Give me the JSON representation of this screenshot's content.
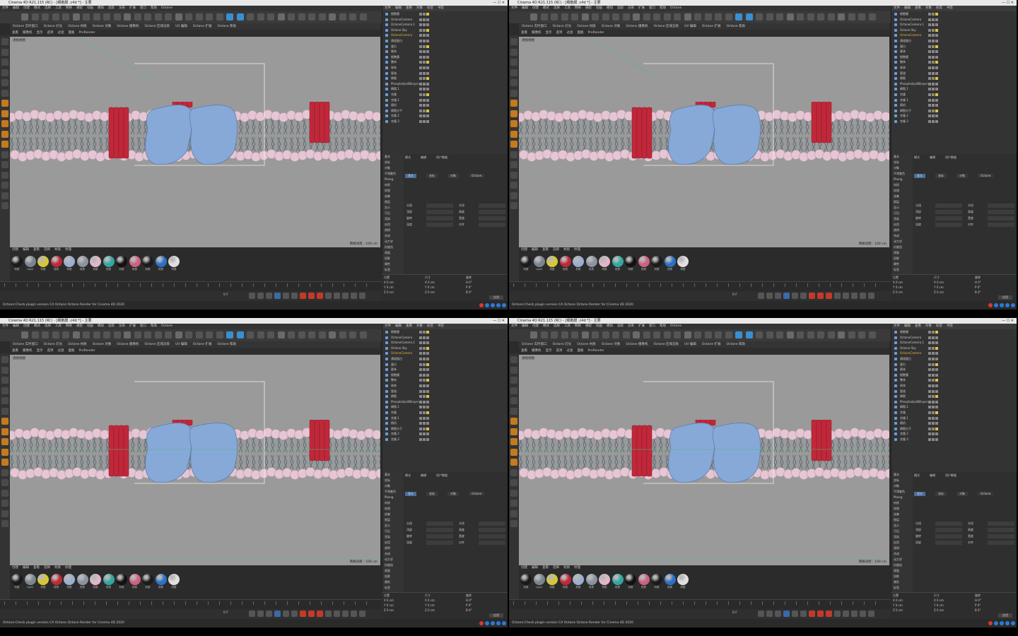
{
  "window": {
    "title": "Cinema 4D R21.115 (RC) - [细胞膜 .c4d *] - 主要"
  },
  "menus": [
    "文件",
    "编辑",
    "创建",
    "模式",
    "选择",
    "工具",
    "网格",
    "捕捉",
    "动画",
    "模拟",
    "追踪",
    "渲染",
    "扩展",
    "窗口",
    "帮助",
    "Octane"
  ],
  "octane_bar": [
    "Octane 实时窗口",
    "Octane 灯光",
    "Octane 材质",
    "Octane 对象",
    "Octane 摄像机",
    "Octane 区域渲染",
    "UV 编辑",
    "Octane 扩展",
    "Octane 帮助"
  ],
  "viewport": {
    "menu": [
      "查看",
      "摄像机",
      "显示",
      "选项",
      "过滤",
      "面板",
      "ProRender"
    ],
    "label": "透视视图",
    "info": "网格间距 : 100 cm"
  },
  "material_bar": {
    "menu": [
      "创建",
      "编辑",
      "查看",
      "选择",
      "材质",
      "纹理"
    ],
    "materials": [
      {
        "label": "材质",
        "color": "#1a1a1a"
      },
      {
        "label": "Lipid",
        "color": "#7a8590"
      },
      {
        "label": "材质",
        "color": "#d8c830"
      },
      {
        "label": "材质",
        "color": "#c02838"
      },
      {
        "label": "材质",
        "color": "#9aaed0"
      },
      {
        "label": "材质",
        "color": "#8a93a0"
      },
      {
        "label": "材质",
        "color": "#e0b8c8"
      },
      {
        "label": "材质",
        "color": "#30a8a0"
      },
      {
        "label": "材质",
        "color": "#111111"
      },
      {
        "label": "材质",
        "color": "#d06080"
      },
      {
        "label": "材质",
        "color": "#1a1a1a"
      },
      {
        "label": "材质",
        "color": "#2a70c8"
      },
      {
        "label": "材质",
        "color": "#e0e0e0"
      }
    ]
  },
  "object_manager": {
    "menu": [
      "文件",
      "编辑",
      "查看",
      "对象",
      "标签",
      "书签"
    ],
    "objects": [
      "细胞膜",
      "OctaneCamera",
      "OctaneCamera.1",
      "Octane Sky",
      "OctaneCamera",
      "通道蛋白",
      "蛋白",
      "载体",
      "细胞膜",
      "整体",
      "球体",
      "管道",
      "磷脂",
      "PhospholipidBilayer",
      "磷脂.1",
      "克隆",
      "克隆.1",
      "随机",
      "磷脂分子",
      "克隆.2",
      "克隆.3"
    ]
  },
  "attributes": {
    "menu": [
      "模式",
      "编辑",
      "用户数据"
    ],
    "side": [
      "基本",
      "坐标",
      "对象",
      "平滑着色",
      "Phong",
      "材质",
      "纹理",
      "选集",
      "图层",
      "显示",
      "可见",
      "渲染",
      "启用",
      "透明",
      "合成",
      "动力学",
      "抗锯齿",
      "视窗",
      "投影",
      "属性",
      "标签"
    ],
    "tabs": [
      "基本",
      "坐标",
      "对象",
      "Octane"
    ],
    "fields": [
      "分段",
      "半径",
      "顶部",
      "高度",
      "旋转",
      "宽度",
      "深度",
      "对齐"
    ]
  },
  "coordinates": {
    "headers": [
      "位置",
      "尺寸",
      "旋转"
    ],
    "rows": [
      [
        "X 0 cm",
        "X 0 cm",
        "H 0°"
      ],
      [
        "Y 0 cm",
        "Y 0 cm",
        "P 0°"
      ],
      [
        "Z 0 cm",
        "Z 0 cm",
        "B 0°"
      ]
    ],
    "apply": "应用"
  },
  "status": "Octane:Check plugin version CA Octane  Octane Render for Cinema 4D 2020",
  "panes": [
    {
      "id": "p1",
      "frame": "0 F"
    },
    {
      "id": "p2",
      "frame": "0 F"
    },
    {
      "id": "p3",
      "frame": "0 F"
    },
    {
      "id": "p4",
      "frame": "0 F"
    }
  ],
  "colors": {
    "membrane_head": "#e6c6d4",
    "protein_blue": "#86a9d8",
    "channel_red": "#c0283a",
    "viewport_bg": "#9a9a9a"
  }
}
